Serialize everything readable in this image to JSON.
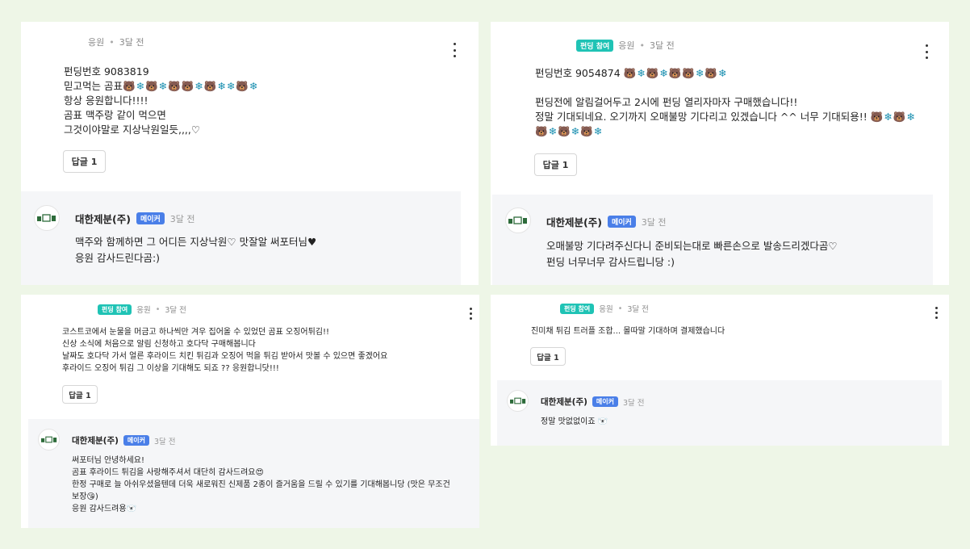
{
  "c1": {
    "meta": {
      "author": "응원",
      "time": "3달 전"
    },
    "lines": [
      "펀딩번호 9083819",
      "믿고먹는 곰표",
      "항상 응원합니다!!!!",
      "곰표 맥주랑 같이 먹으면",
      "그것이야말로 지상낙원일듯,,,,♡"
    ],
    "emoji_line_1": [
      "bear",
      "snow",
      "bear",
      "snow",
      "bear",
      "bear",
      "snow",
      "bear",
      "snow",
      "snow",
      "bear",
      "snow"
    ],
    "reply_button": "답글 1",
    "reply": {
      "name": "대한제분(주)",
      "badge": "메이커",
      "time": "3달 전",
      "lines": [
        "맥주와 함께하면 그 어디든 지상낙원♡ 맛잘알 써포터님♥",
        "응원 감사드린다곰:)"
      ]
    }
  },
  "c2": {
    "meta": {
      "tag": "펀딩 참여",
      "author": "응원",
      "time": "3달 전"
    },
    "line_funding": "펀딩번호 9054874",
    "emoji_funding": [
      "bear",
      "snow",
      "bear",
      "snow",
      "bear",
      "bear",
      "snow",
      "bear",
      "snow"
    ],
    "lines": [
      "펀딩전에 알림걸어두고 2시에 펀딩 열리자마자 구매했습니다!!",
      "정말 기대되네요. 오기까지 오매불망 기다리고 있겠습니다 ^^ 너무 기대되용!!"
    ],
    "emoji_tail": [
      "bear",
      "snow",
      "bear",
      "snow"
    ],
    "emoji_line_next": [
      "bear",
      "snow",
      "bear",
      "snow",
      "bear",
      "snow"
    ],
    "reply_button": "답글 1",
    "reply": {
      "name": "대한제분(주)",
      "badge": "메이커",
      "time": "3달 전",
      "lines": [
        "오매불망 기다려주신다니 준비되는대로 빠른손으로 발송드리겠다곰♡",
        "펀딩 너무너무 감사드립니당 :)"
      ]
    }
  },
  "c3": {
    "meta": {
      "tag": "펀딩 참여",
      "author": "응원",
      "time": "3달 전"
    },
    "lines": [
      "코스트코에서 눈물을 머금고 하나씩만 겨우 집어올 수 있었던 곰표 오징어튀김!!",
      "신상 소식에 처음으로 알림 신청하고 호다닥 구매해봅니다",
      "날짜도 호다닥 가서 얼른 후라이드 치킨 튀김과 오징어 먹을 튀김 받아서 맛볼 수 있으면 좋겠어요",
      "후라이드 오징어 튀김 그 이상을 기대해도 되죠 ?? 응원합니닷!!!"
    ],
    "reply_button": "답글 1",
    "reply": {
      "name": "대한제분(주)",
      "badge": "메이커",
      "time": "3달 전",
      "lines": [
        "써포터님 안녕하세요!",
        "곰표 후라이드 튀김을 사랑해주셔서 대단히 감사드려요😍",
        "한정 구매로 늘 아쉬우셨을텐데 더욱 새로워진 신제품 2종이 즐거움을 드릴 수 있기를 기대해봅니당 (맛은 무조건",
        "보장😘)",
        "응원 감사드려용🐻‍❄️"
      ]
    }
  },
  "c4": {
    "meta": {
      "tag": "펀딩 참여",
      "author": "응원",
      "time": "3달 전"
    },
    "lines": [
      "진미채 튀김 트러플 조합... 몰따말 기대하며 결제했습니다"
    ],
    "reply_button": "답글 1",
    "reply": {
      "name": "대한제분(주)",
      "badge": "메이커",
      "time": "3달 전",
      "lines": [
        "정말 맛없없이죠 🐻‍❄️"
      ]
    }
  },
  "icons": {
    "bear": "🐻",
    "snow": "❄"
  },
  "colors": {
    "background": "#eef6e7",
    "tag": "#1fc3b5",
    "maker_badge": "#4a7fe8",
    "reply_box": "#f5f6f8"
  }
}
